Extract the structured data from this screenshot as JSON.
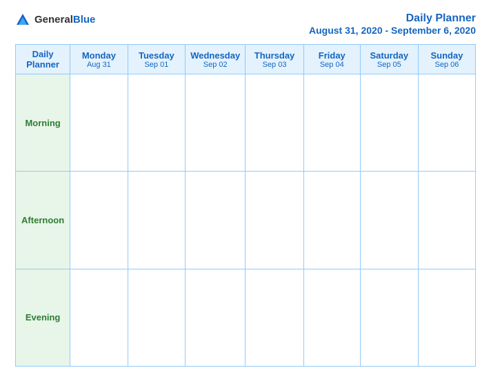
{
  "header": {
    "logo_general": "General",
    "logo_blue": "Blue",
    "title": "Daily Planner",
    "date_range": "August 31, 2020 - September 6, 2020"
  },
  "table": {
    "header_label": "Daily Planner",
    "columns": [
      {
        "day": "Monday",
        "date": "Aug 31"
      },
      {
        "day": "Tuesday",
        "date": "Sep 01"
      },
      {
        "day": "Wednesday",
        "date": "Sep 02"
      },
      {
        "day": "Thursday",
        "date": "Sep 03"
      },
      {
        "day": "Friday",
        "date": "Sep 04"
      },
      {
        "day": "Saturday",
        "date": "Sep 05"
      },
      {
        "day": "Sunday",
        "date": "Sep 06"
      }
    ],
    "rows": [
      {
        "label": "Morning"
      },
      {
        "label": "Afternoon"
      },
      {
        "label": "Evening"
      }
    ]
  }
}
